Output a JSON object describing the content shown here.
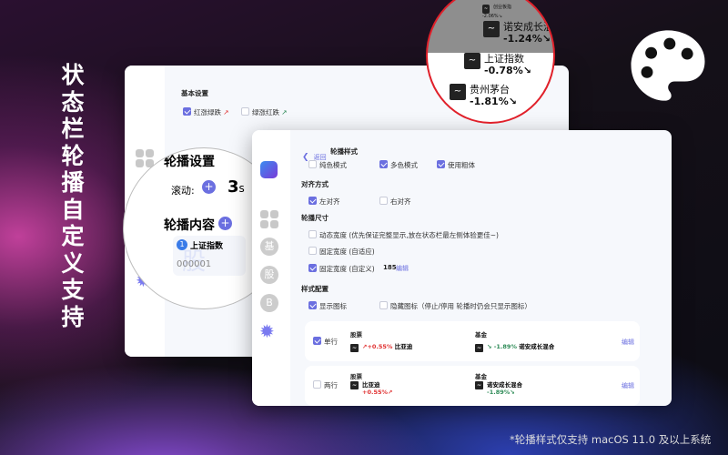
{
  "headline": "状态栏轮播自定义支持",
  "caption": "*轮播样式仅支持 macOS 11.0 及以上系统",
  "back_window": {
    "section": "基本设置",
    "opt1": "红涨绿跌",
    "opt2": "绿涨红跌"
  },
  "magnifier": {
    "title": "轮播设置",
    "scroll_label": "滚动:",
    "scroll_value": "3",
    "scroll_unit": "s",
    "content_title": "轮播内容",
    "item_index": "1",
    "item_name": "上证指数",
    "item_code": "000001",
    "item_watermark": "股"
  },
  "sidebar": {
    "items": [
      "基",
      "股",
      "B"
    ]
  },
  "front_window": {
    "back": "返回",
    "title": "轮播样式",
    "modes": [
      {
        "label": "纯色模式",
        "checked": false
      },
      {
        "label": "多色模式",
        "checked": true
      },
      {
        "label": "使用粗体",
        "checked": true
      }
    ],
    "align_title": "对齐方式",
    "align": [
      {
        "label": "左对齐",
        "checked": true
      },
      {
        "label": "右对齐",
        "checked": false
      }
    ],
    "size_title": "轮播尺寸",
    "sizes": [
      {
        "label": "动态宽度 (优先保证完整显示,放在状态栏最左侧体验更佳~)",
        "checked": false
      },
      {
        "label": "固定宽度 (自适应)",
        "checked": false
      },
      {
        "label": "固定宽度 (自定义)",
        "checked": true
      }
    ],
    "custom_width": "185",
    "edit": "编辑",
    "style_title": "样式配置",
    "icons": [
      {
        "label": "显示图标",
        "checked": true
      },
      {
        "label": "隐藏图标（停止/停用 轮播时仍会只显示图标）",
        "checked": false
      }
    ],
    "rows": [
      {
        "label": "单行",
        "checked": true,
        "stock_h": "股票",
        "stock_change": "↗+0.55%",
        "stock_name": "比亚迪",
        "fund_h": "基金",
        "fund_change": "↘ -1.89%",
        "fund_name": "诺安成长混合",
        "edit": "编辑"
      },
      {
        "label": "两行",
        "checked": false,
        "stock_h": "股票",
        "stock_change": "+0.55%↗",
        "stock_name": "比亚迪",
        "fund_h": "基金",
        "fund_change": "-1.89%↘",
        "fund_name": "诺安成长混合",
        "edit": "编辑"
      }
    ]
  },
  "statusbar": [
    {
      "name": "创业板指",
      "change": "-2.06%↘"
    },
    {
      "name": "诺安成长混",
      "change": "-1.24%↘"
    },
    {
      "name": "上证指数",
      "change": "-0.78%↘"
    },
    {
      "name": "贵州茅台",
      "change": "-1.81%↘"
    }
  ],
  "colors": {
    "accent": "#6b6fe0",
    "up": "#e03030",
    "down": "#2e8b57",
    "ring": "#e0202a"
  }
}
